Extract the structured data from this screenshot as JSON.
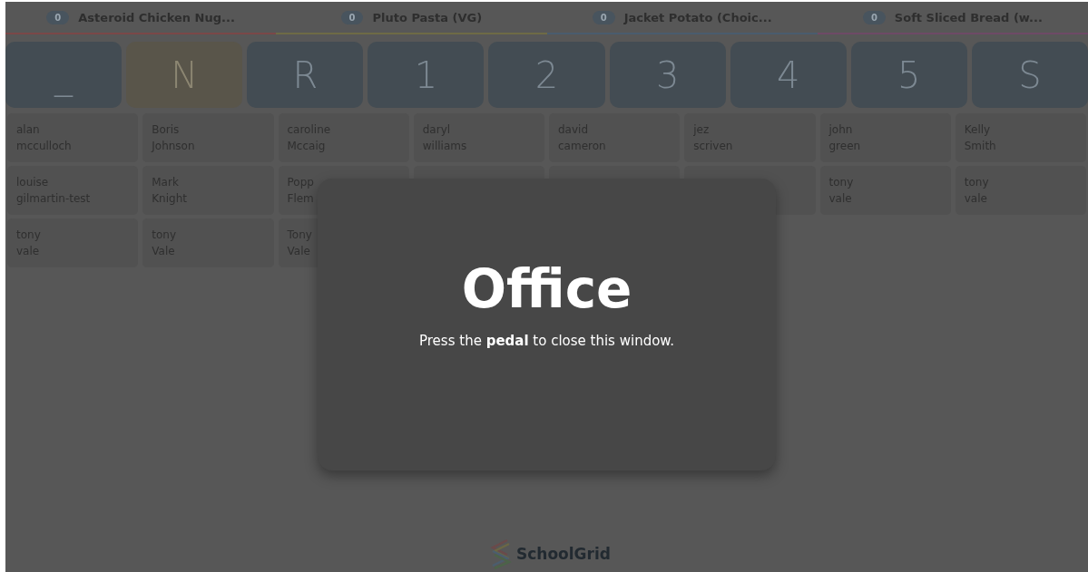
{
  "menu_items": [
    {
      "count": "0",
      "name": "Asteroid Chicken Nug...",
      "color": "#7a4848"
    },
    {
      "count": "0",
      "name": "Pluto Pasta (VG)",
      "color": "#6e6a45"
    },
    {
      "count": "0",
      "name": "Jacket Potato (Choic...",
      "color": "#4a5c6e"
    },
    {
      "count": "0",
      "name": "Soft Sliced Bread (w...",
      "color": "#6e4a66"
    }
  ],
  "keys": [
    {
      "label": "_",
      "selected": false
    },
    {
      "label": "N",
      "selected": true
    },
    {
      "label": "R",
      "selected": false
    },
    {
      "label": "1",
      "selected": false
    },
    {
      "label": "2",
      "selected": false
    },
    {
      "label": "3",
      "selected": false
    },
    {
      "label": "4",
      "selected": false
    },
    {
      "label": "5",
      "selected": false
    },
    {
      "label": "S",
      "selected": false
    }
  ],
  "pupils": [
    {
      "first": "alan",
      "last": "mcculloch"
    },
    {
      "first": "Boris",
      "last": "Johnson"
    },
    {
      "first": "caroline",
      "last": "Mccaig"
    },
    {
      "first": "daryl",
      "last": "williams"
    },
    {
      "first": "david",
      "last": "cameron"
    },
    {
      "first": "jez",
      "last": "scriven"
    },
    {
      "first": "john",
      "last": "green"
    },
    {
      "first": "Kelly",
      "last": "Smith"
    },
    {
      "first": "louise",
      "last": "gilmartin-test"
    },
    {
      "first": "Mark",
      "last": "Knight"
    },
    {
      "first": "Popp",
      "last": "Flem"
    },
    {
      "kind": "hidden"
    },
    {
      "kind": "hidden"
    },
    {
      "kind": "hidden"
    },
    {
      "first": "tony",
      "last": "vale"
    },
    {
      "first": "tony",
      "last": "vale"
    },
    {
      "first": "tony",
      "last": "vale"
    },
    {
      "first": "tony",
      "last": "Vale"
    },
    {
      "first": "Tony",
      "last": "Vale"
    }
  ],
  "dialog": {
    "title": "Office",
    "message": "Press the **pedal** to close this window."
  },
  "logo": {
    "text": "SchoolGrid"
  }
}
